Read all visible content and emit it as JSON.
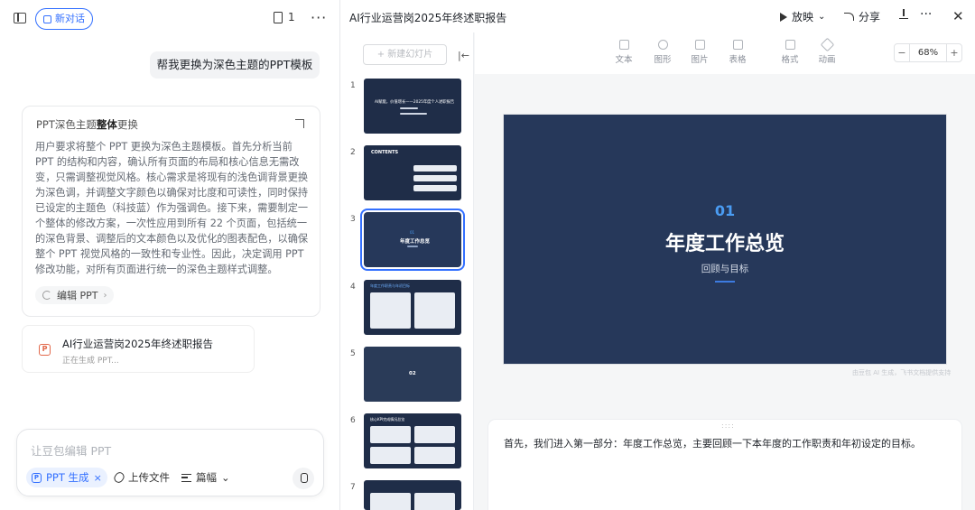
{
  "left": {
    "new_chat": "新对话",
    "doc_count": "1",
    "more": "···",
    "user_message": "帮我更换为深色主题的PPT模板",
    "thinking": {
      "title_prefix": "PPT深色主题",
      "title_bold": "整体",
      "title_suffix": "更换",
      "body": "用户要求将整个 PPT 更换为深色主题模板。首先分析当前 PPT 的结构和内容，确认所有页面的布局和核心信息无需改变，只需调整视觉风格。核心需求是将现有的浅色调背景更换为深色调，并调整文字颜色以确保对比度和可读性，同时保持已设定的主题色（科技蓝）作为强调色。接下来，需要制定一个整体的修改方案，一次性应用到所有 22 个页面，包括统一的深色背景、调整后的文本颜色以及优化的图表配色，以确保整个 PPT 视觉风格的一致性和专业性。因此，决定调用 PPT 修改功能，对所有页面进行统一的深色主题样式调整。",
      "action": "编辑 PPT",
      "action_chevron": "›"
    },
    "ppt_card": {
      "badge": "P",
      "title": "AI行业运营岗2025年终述职报告",
      "status": "正在生成 PPT..."
    },
    "input": {
      "placeholder": "让豆包编辑 PPT",
      "chip_badge": "P",
      "chip_label": "PPT 生成",
      "chip_close": "×",
      "upload": "上传文件",
      "length": "篇幅",
      "length_chevron": "⌄"
    }
  },
  "right": {
    "title": "AI行业运营岗2025年终述职报告",
    "play": "放映",
    "play_chevron": "⌄",
    "share": "分享",
    "more": "···",
    "close": "✕",
    "new_slide": "+ 新建幻灯片",
    "collapse": "|←",
    "toolbar": [
      "文本",
      "图形",
      "图片",
      "表格",
      "格式",
      "动画"
    ],
    "zoom": {
      "minus": "−",
      "value": "68%",
      "plus": "+"
    },
    "thumbnails": [
      {
        "num": "1",
        "title": "AI赋能，价值增长——2025年度个人述职报告"
      },
      {
        "num": "2",
        "title": "CONTENTS"
      },
      {
        "num": "3",
        "title": "年度工作总览"
      },
      {
        "num": "4",
        "title": "年度工作职责与年初目标"
      },
      {
        "num": "5",
        "title": "02"
      },
      {
        "num": "6",
        "title": "核心KPI完成情况总览"
      },
      {
        "num": "7",
        "title": ""
      }
    ],
    "slide": {
      "number": "01",
      "title": "年度工作总览",
      "subtitle": "回顾与目标"
    },
    "watermark": "由豆包 AI 生成，飞书文档提供支持",
    "notes_handle": "::::",
    "notes": "首先，我们进入第一部分：年度工作总览，主要回顾一下本年度的工作职责和年初设定的目标。"
  }
}
